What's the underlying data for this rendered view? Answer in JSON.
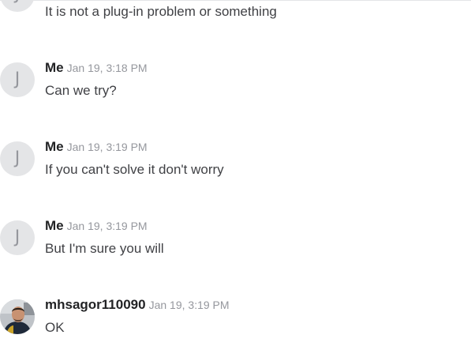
{
  "messages": [
    {
      "avatar_initial": "J",
      "text": "It is not a plug-in problem or something"
    },
    {
      "avatar_initial": "J",
      "sender": "Me",
      "time": "Jan 19, 3:18 PM",
      "text": "Can we try?"
    },
    {
      "avatar_initial": "J",
      "sender": "Me",
      "time": "Jan 19, 3:19 PM",
      "text": "If you can't solve it don't worry"
    },
    {
      "avatar_initial": "J",
      "sender": "Me",
      "time": "Jan 19, 3:19 PM",
      "text": "But I'm sure you will"
    },
    {
      "avatar_icon": "user-photo-avatar",
      "sender": "mhsagor110090",
      "time": "Jan 19, 3:19 PM",
      "text": "OK"
    }
  ]
}
